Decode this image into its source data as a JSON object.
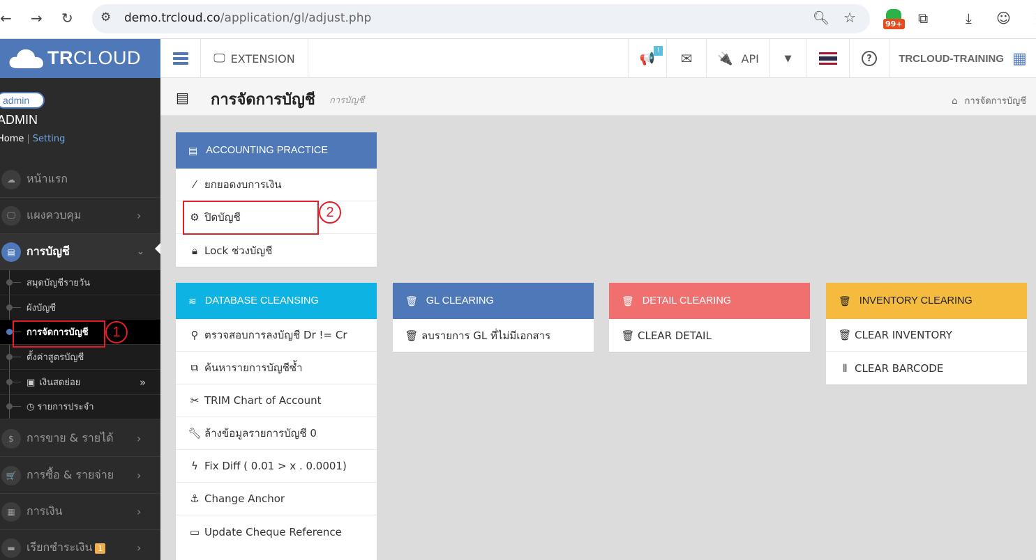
{
  "browser": {
    "url_domain": "demo.trcloud.co",
    "url_path": "/application/gl/adjust.php",
    "ext_badge": "99+"
  },
  "logo": {
    "brand_bold": "TR",
    "brand_rest": "CLOUD"
  },
  "topbar": {
    "extension_label": "EXTENSION",
    "announcement_badge": "!",
    "api_label": "API",
    "company": "TRCLOUD-TRAINING"
  },
  "user": {
    "avatar_alt": "admin",
    "name": "ADMIN",
    "home_link": "Home",
    "separator": "|",
    "setting_link": "Setting"
  },
  "sidebar": {
    "menu": [
      {
        "label": "หน้าแรก"
      },
      {
        "label": "แผงควบคุม"
      },
      {
        "label": "การบัญชี"
      },
      {
        "label": "การขาย & รายได้"
      },
      {
        "label": "การซื้อ & รายจ่าย"
      },
      {
        "label": "การเงิน"
      },
      {
        "label": "เรียกชำระเงิน",
        "badge": "1"
      }
    ],
    "submenu": [
      {
        "label": "สมุดบัญชีรายวัน"
      },
      {
        "label": "ผังบัญชี"
      },
      {
        "label": "การจัดการบัญชี"
      },
      {
        "label": "ตั้งค่าสูตรบัญชี"
      },
      {
        "label": "เงินสดย่อย"
      },
      {
        "label": "รายการประจำ"
      }
    ]
  },
  "content": {
    "title": "การจัดการบัญชี",
    "subtitle": "การบัญชี",
    "breadcrumb": "การจัดการบัญชี"
  },
  "panels": {
    "accounting_practice": {
      "title": "ACCOUNTING PRACTICE",
      "rows": [
        "ยกยอดงบการเงิน",
        "ปิดบัญชี",
        "Lock ช่วงบัญชี"
      ]
    },
    "database_cleansing": {
      "title": "DATABASE CLEANSING",
      "rows": [
        "ตรวจสอบการลงบัญชี Dr != Cr",
        "ค้นหารายการบัญชีซ้ำ",
        "TRIM Chart of Account",
        "ล้างข้อมูลรายการบัญชี 0",
        "Fix Diff ( 0.01 > x . 0.0001)",
        "Change Anchor",
        "Update Cheque Reference"
      ]
    },
    "gl_clearing": {
      "title": "GL CLEARING",
      "rows": [
        "ลบรายการ GL ที่ไม่มีเอกสาร"
      ]
    },
    "detail_clearing": {
      "title": "DETAIL CLEARING",
      "rows": [
        "CLEAR DETAIL"
      ]
    },
    "inventory_clearing": {
      "title": "INVENTORY CLEARING",
      "rows": [
        "CLEAR INVENTORY",
        "CLEAR BARCODE"
      ]
    }
  },
  "annotations": {
    "one": "1",
    "two": "2"
  },
  "colors": {
    "brand_blue": "#4f78b8",
    "cleansing_cyan": "#0db4e3",
    "detail_red": "#f07070",
    "inventory_yellow": "#f5bb3f",
    "annotation_red": "#e21f26"
  }
}
